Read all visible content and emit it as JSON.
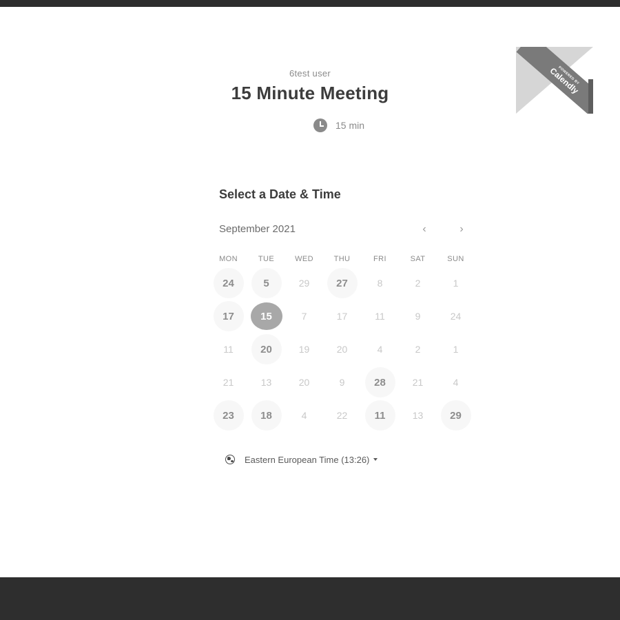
{
  "ribbon": {
    "top_text": "POWERED BY",
    "brand": "Calendly"
  },
  "event": {
    "organizer": "6test user",
    "title": "15 Minute Meeting",
    "duration": "15 min"
  },
  "calendar": {
    "heading": "Select a Date & Time",
    "month_label": "September 2021",
    "weekdays": [
      "MON",
      "TUE",
      "WED",
      "THU",
      "FRI",
      "SAT",
      "SUN"
    ],
    "weeks": [
      [
        {
          "d": "24",
          "s": "available"
        },
        {
          "d": "5",
          "s": "available"
        },
        {
          "d": "29",
          "s": "unavailable"
        },
        {
          "d": "27",
          "s": "available"
        },
        {
          "d": "8",
          "s": "unavailable"
        },
        {
          "d": "2",
          "s": "unavailable"
        },
        {
          "d": "1",
          "s": "unavailable"
        }
      ],
      [
        {
          "d": "17",
          "s": "available"
        },
        {
          "d": "15",
          "s": "selected"
        },
        {
          "d": "7",
          "s": "unavailable"
        },
        {
          "d": "17",
          "s": "unavailable"
        },
        {
          "d": "11",
          "s": "unavailable"
        },
        {
          "d": "9",
          "s": "unavailable"
        },
        {
          "d": "24",
          "s": "unavailable"
        }
      ],
      [
        {
          "d": "11",
          "s": "unavailable"
        },
        {
          "d": "20",
          "s": "available"
        },
        {
          "d": "19",
          "s": "unavailable"
        },
        {
          "d": "20",
          "s": "unavailable"
        },
        {
          "d": "4",
          "s": "unavailable"
        },
        {
          "d": "2",
          "s": "unavailable"
        },
        {
          "d": "1",
          "s": "unavailable"
        }
      ],
      [
        {
          "d": "21",
          "s": "unavailable"
        },
        {
          "d": "13",
          "s": "unavailable"
        },
        {
          "d": "20",
          "s": "unavailable"
        },
        {
          "d": "9",
          "s": "unavailable"
        },
        {
          "d": "28",
          "s": "available"
        },
        {
          "d": "21",
          "s": "unavailable"
        },
        {
          "d": "4",
          "s": "unavailable"
        }
      ],
      [
        {
          "d": "23",
          "s": "available"
        },
        {
          "d": "18",
          "s": "available"
        },
        {
          "d": "4",
          "s": "unavailable"
        },
        {
          "d": "22",
          "s": "unavailable"
        },
        {
          "d": "11",
          "s": "available"
        },
        {
          "d": "13",
          "s": "unavailable"
        },
        {
          "d": "29",
          "s": "available"
        }
      ]
    ]
  },
  "timezone": {
    "label": "Eastern European Time (13:26)"
  },
  "icons": {
    "duration": "clock-icon",
    "timezone": "globe-icon",
    "prev": "chevron-left-icon",
    "next": "chevron-right-icon",
    "dropdown": "caret-down-icon"
  }
}
